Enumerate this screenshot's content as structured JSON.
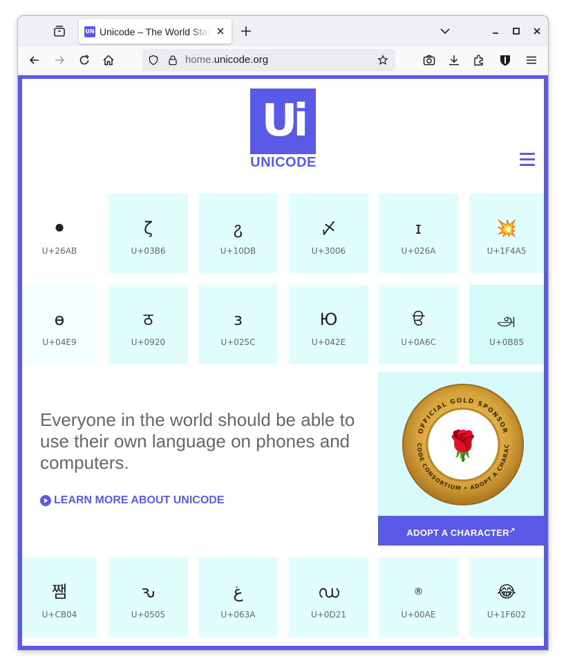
{
  "browser": {
    "tab_title": "Unicode – The World Standard for Text and Emoji",
    "favicon_text": "UN",
    "url_dim": "home.",
    "url_main": "unicode.org"
  },
  "site": {
    "logo_glyph": "Ui",
    "logo_text": "UNICODE",
    "brand_color": "#5a5ae6",
    "tile_color": "#e1fefd"
  },
  "tiles_row1": [
    {
      "glyph": "⚫",
      "code": "U+26AB"
    },
    {
      "glyph": "ζ",
      "code": "U+03B6"
    },
    {
      "glyph": "ჷ",
      "code": "U+10DB"
    },
    {
      "glyph": "〆",
      "code": "U+3006"
    },
    {
      "glyph": "ɪ",
      "code": "U+026A"
    },
    {
      "glyph": "💥",
      "code": "U+1F4A5"
    }
  ],
  "tiles_row2": [
    {
      "glyph": "ө",
      "code": "U+04E9"
    },
    {
      "glyph": "ठ",
      "code": "U+0920"
    },
    {
      "glyph": "ɜ",
      "code": "U+025C"
    },
    {
      "glyph": "Ю",
      "code": "U+042E"
    },
    {
      "glyph": "ੳ",
      "code": "U+0A6C"
    },
    {
      "glyph": "அ",
      "code": "U+0B85"
    }
  ],
  "tiles_row3": [
    {
      "glyph": "쨈",
      "code": "U+CB04"
    },
    {
      "glyph": "ԅ",
      "code": "U+0505"
    },
    {
      "glyph": "غ",
      "code": "U+063A"
    },
    {
      "glyph": "ഡ",
      "code": "U+0D21"
    },
    {
      "glyph": "®",
      "code": "U+00AE"
    },
    {
      "glyph": "😂",
      "code": "U+1F602"
    }
  ],
  "hero": {
    "tagline": "Everyone in the world should be able to use their own language on phones and computers.",
    "learn_more": "LEARN MORE ABOUT UNICODE"
  },
  "sponsor": {
    "badge_top": "OFFICIAL GOLD SPONSOR",
    "badge_bottom": "UNICODE CONSORTIUM • ADOPT A CHARACTER",
    "badge_emoji": "🌹",
    "adopt_label": "ADOPT A CHARACTER",
    "adopt_ext": "↗"
  }
}
